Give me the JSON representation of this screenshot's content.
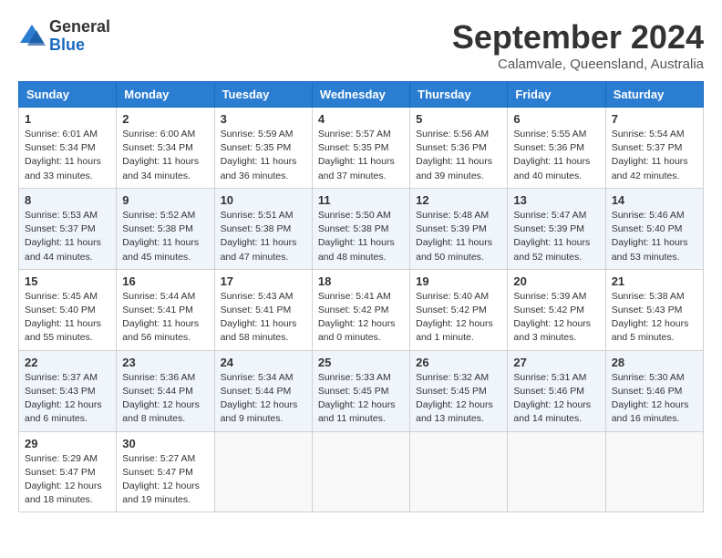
{
  "header": {
    "logo_general": "General",
    "logo_blue": "Blue",
    "month": "September 2024",
    "location": "Calamvale, Queensland, Australia"
  },
  "weekdays": [
    "Sunday",
    "Monday",
    "Tuesday",
    "Wednesday",
    "Thursday",
    "Friday",
    "Saturday"
  ],
  "weeks": [
    [
      {
        "day": "1",
        "sunrise": "6:01 AM",
        "sunset": "5:34 PM",
        "daylight": "11 hours and 33 minutes."
      },
      {
        "day": "2",
        "sunrise": "6:00 AM",
        "sunset": "5:34 PM",
        "daylight": "11 hours and 34 minutes."
      },
      {
        "day": "3",
        "sunrise": "5:59 AM",
        "sunset": "5:35 PM",
        "daylight": "11 hours and 36 minutes."
      },
      {
        "day": "4",
        "sunrise": "5:57 AM",
        "sunset": "5:35 PM",
        "daylight": "11 hours and 37 minutes."
      },
      {
        "day": "5",
        "sunrise": "5:56 AM",
        "sunset": "5:36 PM",
        "daylight": "11 hours and 39 minutes."
      },
      {
        "day": "6",
        "sunrise": "5:55 AM",
        "sunset": "5:36 PM",
        "daylight": "11 hours and 40 minutes."
      },
      {
        "day": "7",
        "sunrise": "5:54 AM",
        "sunset": "5:37 PM",
        "daylight": "11 hours and 42 minutes."
      }
    ],
    [
      {
        "day": "8",
        "sunrise": "5:53 AM",
        "sunset": "5:37 PM",
        "daylight": "11 hours and 44 minutes."
      },
      {
        "day": "9",
        "sunrise": "5:52 AM",
        "sunset": "5:38 PM",
        "daylight": "11 hours and 45 minutes."
      },
      {
        "day": "10",
        "sunrise": "5:51 AM",
        "sunset": "5:38 PM",
        "daylight": "11 hours and 47 minutes."
      },
      {
        "day": "11",
        "sunrise": "5:50 AM",
        "sunset": "5:38 PM",
        "daylight": "11 hours and 48 minutes."
      },
      {
        "day": "12",
        "sunrise": "5:48 AM",
        "sunset": "5:39 PM",
        "daylight": "11 hours and 50 minutes."
      },
      {
        "day": "13",
        "sunrise": "5:47 AM",
        "sunset": "5:39 PM",
        "daylight": "11 hours and 52 minutes."
      },
      {
        "day": "14",
        "sunrise": "5:46 AM",
        "sunset": "5:40 PM",
        "daylight": "11 hours and 53 minutes."
      }
    ],
    [
      {
        "day": "15",
        "sunrise": "5:45 AM",
        "sunset": "5:40 PM",
        "daylight": "11 hours and 55 minutes."
      },
      {
        "day": "16",
        "sunrise": "5:44 AM",
        "sunset": "5:41 PM",
        "daylight": "11 hours and 56 minutes."
      },
      {
        "day": "17",
        "sunrise": "5:43 AM",
        "sunset": "5:41 PM",
        "daylight": "11 hours and 58 minutes."
      },
      {
        "day": "18",
        "sunrise": "5:41 AM",
        "sunset": "5:42 PM",
        "daylight": "12 hours and 0 minutes."
      },
      {
        "day": "19",
        "sunrise": "5:40 AM",
        "sunset": "5:42 PM",
        "daylight": "12 hours and 1 minute."
      },
      {
        "day": "20",
        "sunrise": "5:39 AM",
        "sunset": "5:42 PM",
        "daylight": "12 hours and 3 minutes."
      },
      {
        "day": "21",
        "sunrise": "5:38 AM",
        "sunset": "5:43 PM",
        "daylight": "12 hours and 5 minutes."
      }
    ],
    [
      {
        "day": "22",
        "sunrise": "5:37 AM",
        "sunset": "5:43 PM",
        "daylight": "12 hours and 6 minutes."
      },
      {
        "day": "23",
        "sunrise": "5:36 AM",
        "sunset": "5:44 PM",
        "daylight": "12 hours and 8 minutes."
      },
      {
        "day": "24",
        "sunrise": "5:34 AM",
        "sunset": "5:44 PM",
        "daylight": "12 hours and 9 minutes."
      },
      {
        "day": "25",
        "sunrise": "5:33 AM",
        "sunset": "5:45 PM",
        "daylight": "12 hours and 11 minutes."
      },
      {
        "day": "26",
        "sunrise": "5:32 AM",
        "sunset": "5:45 PM",
        "daylight": "12 hours and 13 minutes."
      },
      {
        "day": "27",
        "sunrise": "5:31 AM",
        "sunset": "5:46 PM",
        "daylight": "12 hours and 14 minutes."
      },
      {
        "day": "28",
        "sunrise": "5:30 AM",
        "sunset": "5:46 PM",
        "daylight": "12 hours and 16 minutes."
      }
    ],
    [
      {
        "day": "29",
        "sunrise": "5:29 AM",
        "sunset": "5:47 PM",
        "daylight": "12 hours and 18 minutes."
      },
      {
        "day": "30",
        "sunrise": "5:27 AM",
        "sunset": "5:47 PM",
        "daylight": "12 hours and 19 minutes."
      },
      null,
      null,
      null,
      null,
      null
    ]
  ]
}
